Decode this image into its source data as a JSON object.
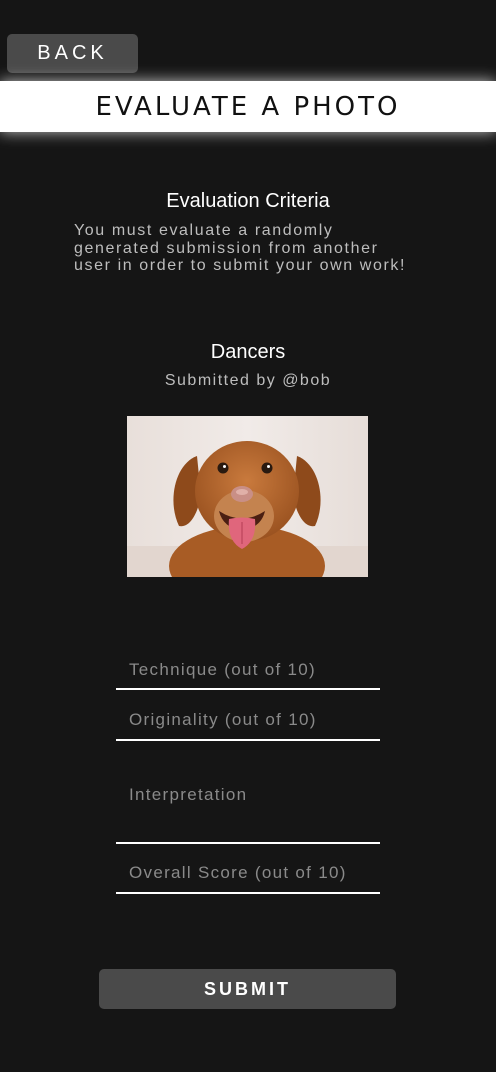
{
  "nav": {
    "back_label": "BACK"
  },
  "header": {
    "title": "EVALUATE A PHOTO"
  },
  "criteria": {
    "heading": "Evaluation Criteria",
    "text": "You must evaluate a randomly generated submission from another user in order to submit your own work!"
  },
  "submission": {
    "title": "Dancers",
    "author": "Submitted by @bob",
    "photo_alt": "dog-photo"
  },
  "form": {
    "technique_placeholder": "Technique (out of 10)",
    "originality_placeholder": "Originality (out of 10)",
    "interpretation_placeholder": "Interpretation",
    "overall_placeholder": "Overall Score (out of 10)",
    "submit_label": "SUBMIT"
  },
  "colors": {
    "background": "#151515",
    "button": "#4a4a4a",
    "banner": "#ffffff",
    "muted_text": "#bdbdbd",
    "placeholder": "#8a8a8a"
  }
}
